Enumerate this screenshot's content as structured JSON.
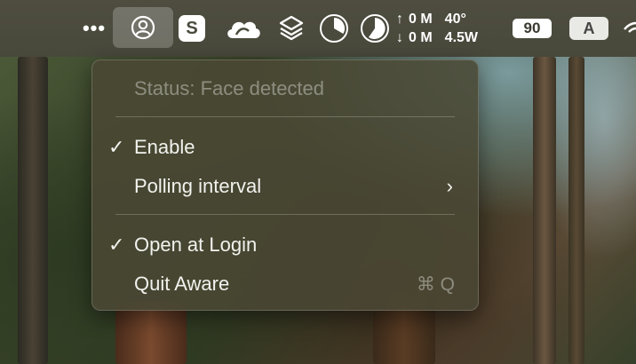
{
  "menubar": {
    "overflow_icon": "ellipsis-icon",
    "aware_icon": "person-circle-icon",
    "s_label": "S",
    "cloud_icon": "cloud-icon",
    "layers_icon": "layers-icon",
    "pie1_icon": "pie-chart-icon",
    "pie2_icon": "pie-chart-icon",
    "net_up_arrow": "↑",
    "net_up_value": "0 M",
    "temperature": "40°",
    "net_down_arrow": "↓",
    "net_down_value": "0 M",
    "power": "4.5W",
    "battery_level": "90",
    "input_source": "A"
  },
  "menu": {
    "status": "Status: Face detected",
    "items": [
      {
        "label": "Enable",
        "checked": true,
        "check_mark": "✓"
      },
      {
        "label": "Polling interval",
        "submenu_arrow": "›"
      },
      {
        "label": "Open at Login",
        "checked": true,
        "check_mark": "✓"
      },
      {
        "label": "Quit Aware",
        "shortcut": "⌘ Q"
      }
    ]
  }
}
